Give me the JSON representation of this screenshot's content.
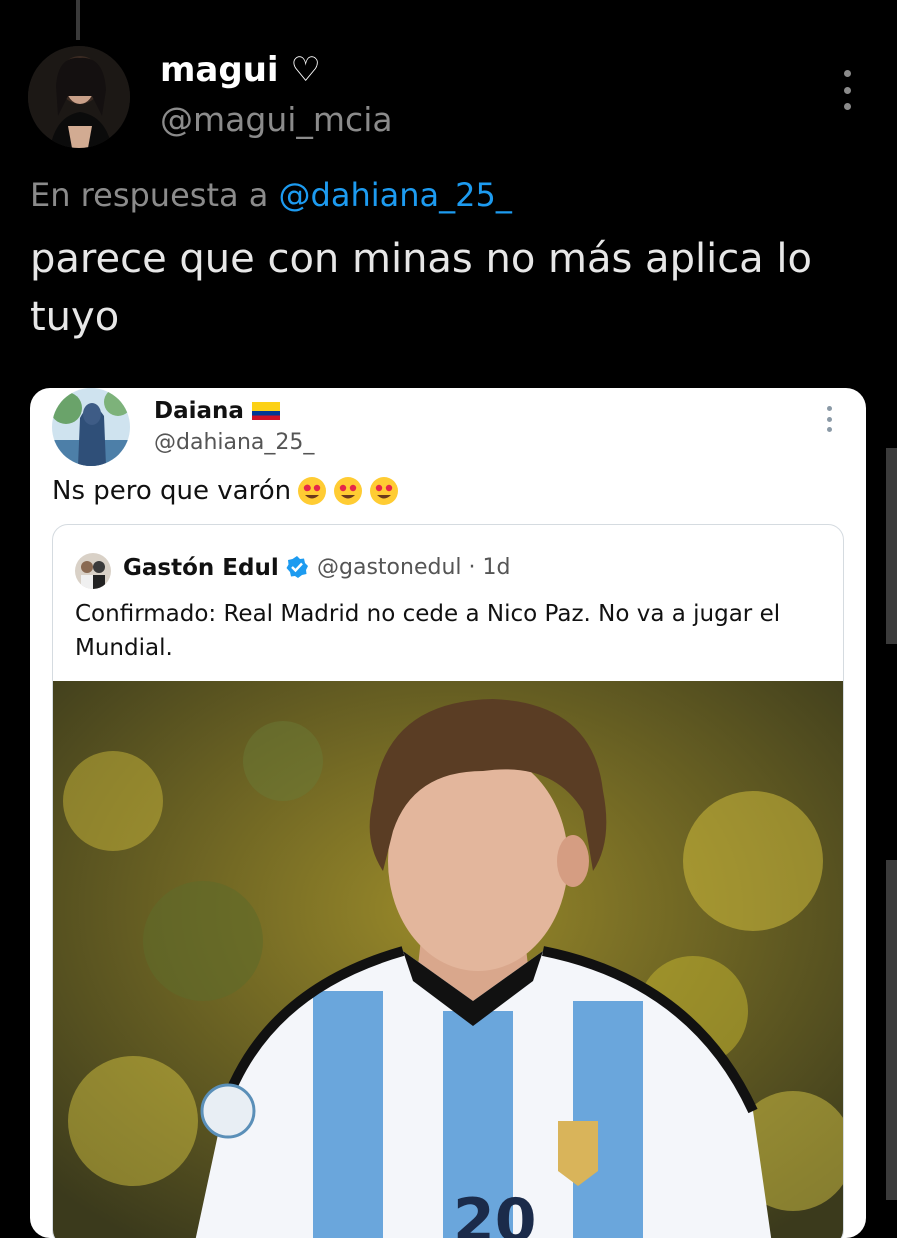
{
  "reply": {
    "author": {
      "name": "magui ♡",
      "handle": "@magui_mcia"
    },
    "reply_prefix": "En respuesta a",
    "reply_mention": "@dahiana_25_",
    "text": "parece que con minas no más aplica lo tuyo"
  },
  "quoted": {
    "author": {
      "name": "Daiana",
      "handle": "@dahiana_25_"
    },
    "text": "Ns pero que varón",
    "nested": {
      "name": "Gastón Edul",
      "handle_time": "@gastonedul · 1d",
      "text": "Confirmado: Real Madrid no cede a Nico Paz. No va a jugar el Mundial.",
      "photo_label": "Player in Argentina national team jersey"
    }
  },
  "colors": {
    "mention": "#1d9bf0",
    "verified": "#1d9bf0",
    "muted": "#8b8b8b"
  },
  "icons": [
    "more-vertical-icon",
    "colombia-flag-icon",
    "heart-eyes-emoji",
    "verified-badge-icon"
  ]
}
